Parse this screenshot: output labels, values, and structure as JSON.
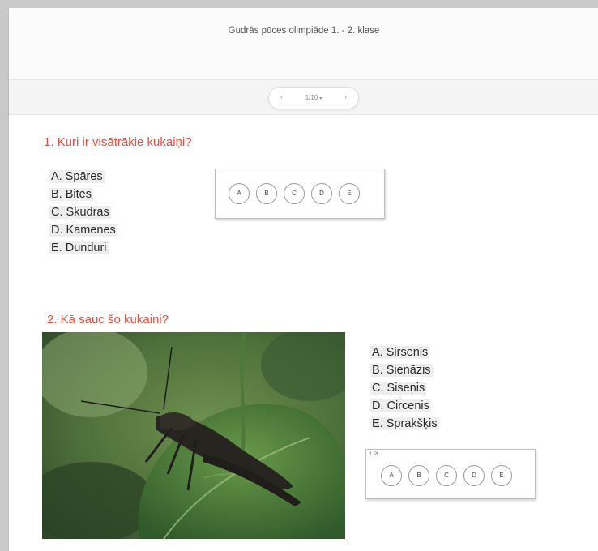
{
  "header": {
    "title": "Gudrās pūces olimpiāde 1. - 2. klase"
  },
  "pager": {
    "prev": "‹",
    "count": "1/10",
    "caret": "▾",
    "next": "›"
  },
  "questions": [
    {
      "title": "1. Kuri ir visātrākie kukaiņi?",
      "options": [
        "A. Spāres",
        "B. Bites",
        "C. Skudras",
        "D. Kamenes",
        "E. Dunduri"
      ],
      "answers": [
        "A",
        "B",
        "C",
        "D",
        "E"
      ]
    },
    {
      "title": "2. Kā sauc šo kukaini?",
      "options": [
        "A. Sirsenis",
        "B. Sienāzis",
        "C. Sisenis",
        "D. Circenis",
        "E. Sprakšķis"
      ],
      "points": "1 Pt",
      "answers": [
        "A",
        "B",
        "C",
        "D",
        "E"
      ],
      "image": "grasshopper-photo"
    }
  ],
  "colors": {
    "question_title": "#f04a3c",
    "highlight": "#eeeeee"
  }
}
